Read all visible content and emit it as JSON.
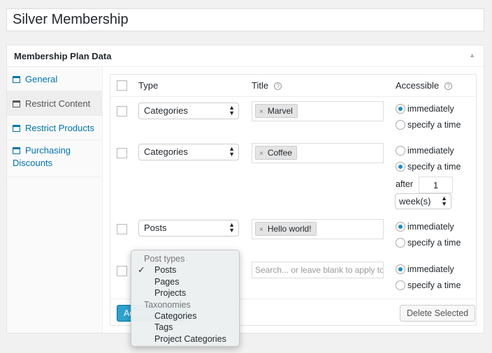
{
  "plan_title": "Silver Membership",
  "panel": {
    "title": "Membership Plan Data",
    "toggle_icon": "▲"
  },
  "sidebar": {
    "items": [
      {
        "label": "General"
      },
      {
        "label": "Restrict Content"
      },
      {
        "label": "Restrict Products"
      },
      {
        "label": "Purchasing Discounts"
      }
    ],
    "active": "Restrict Content"
  },
  "table": {
    "headers": {
      "type": "Type",
      "title": "Title",
      "accessible": "Accessible",
      "help": "?"
    },
    "rows": [
      {
        "type": "Categories",
        "title_tag": "Marvel",
        "access": "immediately"
      },
      {
        "type": "Categories",
        "title_tag": "Coffee",
        "access": "specify a time",
        "after_label": "after",
        "after_value": "1",
        "period": "week(s)"
      },
      {
        "type": "Posts",
        "title_tag": "Hello world!",
        "access": "immediately"
      },
      {
        "type": "Posts",
        "title_placeholder": "Search... or leave blank to apply to all",
        "access": "immediately"
      }
    ],
    "radio_labels": {
      "immediately": "immediately",
      "specify": "specify a time"
    },
    "tag_remove": "×",
    "add_button": "Add New Rule",
    "delete_button": "Delete Selected"
  },
  "dropdown": {
    "groups": [
      {
        "label": "Post types",
        "options": [
          "Posts",
          "Pages",
          "Projects"
        ]
      },
      {
        "label": "Taxonomies",
        "options": [
          "Categories",
          "Tags",
          "Project Categories"
        ]
      }
    ],
    "selected": "Posts",
    "check": "✓"
  },
  "colors": {
    "accent": "#0073aa",
    "button_primary": "#2ea2cc"
  }
}
